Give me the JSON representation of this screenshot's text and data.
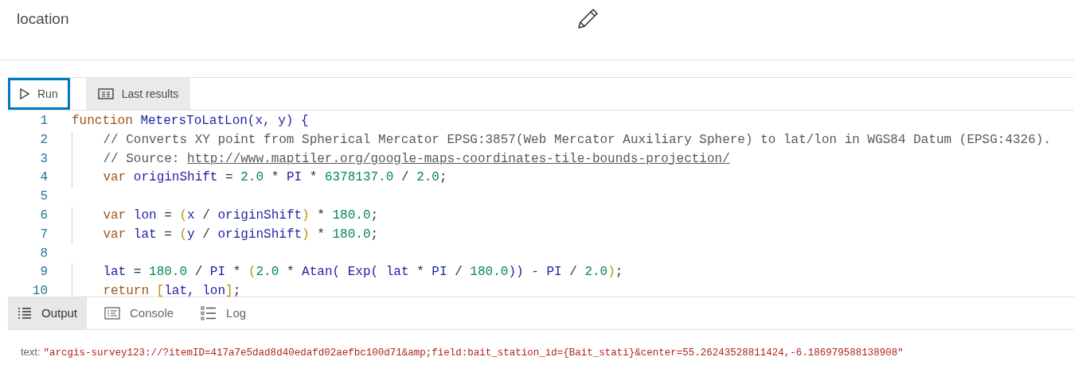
{
  "header": {
    "title": "location"
  },
  "toolbar": {
    "buttons": [
      {
        "label": "Run",
        "kind": "run",
        "focused": true
      },
      {
        "label": "Last results",
        "kind": "results",
        "focused": false
      }
    ]
  },
  "editor": {
    "lines": [
      {
        "number": "1",
        "tokens": [
          {
            "kind": "keyword",
            "text": "function"
          },
          {
            "kind": "ident",
            "text": " MetersToLatLon(x, y) {"
          }
        ]
      },
      {
        "number": "2",
        "tokens": [
          {
            "kind": "comment",
            "text": "    // Converts XY point from Spherical Mercator EPSG:3857(Web Mercator Auxiliary Sphere) to lat/lon in WGS84 Datum (EPSG:4326)."
          }
        ]
      },
      {
        "number": "3",
        "tokens": [
          {
            "kind": "comment",
            "text": "    // Source: "
          },
          {
            "kind": "link",
            "text": "http://www.maptiler.org/google-maps-coordinates-tile-bounds-projection/"
          }
        ]
      },
      {
        "number": "4",
        "tokens": [
          {
            "kind": "keyword",
            "text": "    var"
          },
          {
            "kind": "ident",
            "text": " originShift"
          },
          {
            "kind": "op",
            "text": " = "
          },
          {
            "kind": "number",
            "text": "2.0"
          },
          {
            "kind": "op",
            "text": " * "
          },
          {
            "kind": "ident",
            "text": "PI"
          },
          {
            "kind": "op",
            "text": " * "
          },
          {
            "kind": "number",
            "text": "6378137.0"
          },
          {
            "kind": "op",
            "text": " / "
          },
          {
            "kind": "number",
            "text": "2.0"
          },
          {
            "kind": "op",
            "text": ";"
          }
        ]
      },
      {
        "number": "5"
      },
      {
        "number": "6",
        "tokens": [
          {
            "kind": "keyword",
            "text": "    var"
          },
          {
            "kind": "ident",
            "text": " lon"
          },
          {
            "kind": "op",
            "text": " = "
          },
          {
            "kind": "bracket",
            "text": "("
          },
          {
            "kind": "ident",
            "text": "x"
          },
          {
            "kind": "op",
            "text": " / "
          },
          {
            "kind": "ident",
            "text": "originShift"
          },
          {
            "kind": "bracket",
            "text": ")"
          },
          {
            "kind": "op",
            "text": " * "
          },
          {
            "kind": "number",
            "text": "180.0"
          },
          {
            "kind": "op",
            "text": ";"
          }
        ]
      },
      {
        "number": "7",
        "tokens": [
          {
            "kind": "keyword",
            "text": "    var"
          },
          {
            "kind": "ident",
            "text": " lat"
          },
          {
            "kind": "op",
            "text": " = "
          },
          {
            "kind": "bracket",
            "text": "("
          },
          {
            "kind": "ident",
            "text": "y"
          },
          {
            "kind": "op",
            "text": " / "
          },
          {
            "kind": "ident",
            "text": "originShift"
          },
          {
            "kind": "bracket",
            "text": ")"
          },
          {
            "kind": "op",
            "text": " * "
          },
          {
            "kind": "number",
            "text": "180.0"
          },
          {
            "kind": "op",
            "text": ";"
          }
        ]
      },
      {
        "number": "8"
      },
      {
        "number": "9",
        "tokens": [
          {
            "kind": "ident",
            "text": "    lat"
          },
          {
            "kind": "op",
            "text": " = "
          },
          {
            "kind": "number",
            "text": "180.0"
          },
          {
            "kind": "op",
            "text": " / "
          },
          {
            "kind": "ident",
            "text": "PI"
          },
          {
            "kind": "op",
            "text": " * "
          },
          {
            "kind": "bracket",
            "text": "("
          },
          {
            "kind": "number",
            "text": "2.0"
          },
          {
            "kind": "op",
            "text": " * "
          },
          {
            "kind": "ident",
            "text": "Atan( Exp( lat"
          },
          {
            "kind": "op",
            "text": " * "
          },
          {
            "kind": "ident",
            "text": "PI"
          },
          {
            "kind": "op",
            "text": " / "
          },
          {
            "kind": "number",
            "text": "180.0"
          },
          {
            "kind": "ident",
            "text": "))"
          },
          {
            "kind": "op",
            "text": " - "
          },
          {
            "kind": "ident",
            "text": "PI"
          },
          {
            "kind": "op",
            "text": " / "
          },
          {
            "kind": "number",
            "text": "2.0"
          },
          {
            "kind": "bracket",
            "text": ")"
          },
          {
            "kind": "op",
            "text": ";"
          }
        ]
      },
      {
        "number": "10",
        "tokens": [
          {
            "kind": "keyword",
            "text": "    return"
          },
          {
            "kind": "bracket",
            "text": " ["
          },
          {
            "kind": "ident",
            "text": "lat, lon"
          },
          {
            "kind": "bracket",
            "text": "]"
          },
          {
            "kind": "op",
            "text": ";"
          }
        ]
      }
    ]
  },
  "output_tabs": [
    {
      "label": "Output",
      "kind": "output",
      "selected": true
    },
    {
      "label": "Console",
      "kind": "console",
      "selected": false
    },
    {
      "label": "Log",
      "kind": "log",
      "selected": false
    }
  ],
  "output": {
    "label": "text:",
    "value": "\"arcgis-survey123://?itemID=417a7e5dad8d40edafd02aefbc100d71&amp;field:bait_station_id={Bait_stati}&center=55.26243528811424,-6.186979588138908\""
  }
}
